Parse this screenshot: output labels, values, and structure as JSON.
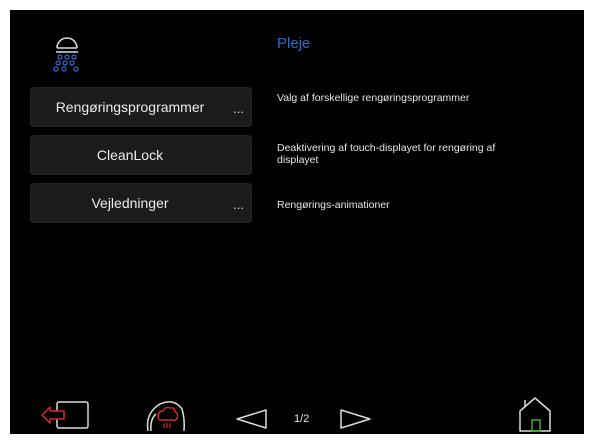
{
  "header": {
    "title": "Pleje",
    "icon": "shower-icon"
  },
  "menu": [
    {
      "label": "Rengøringsprogrammer",
      "has_more": true,
      "more": "...",
      "description": "Valg af forskellige rengøringsprogrammer"
    },
    {
      "label": "CleanLock",
      "has_more": false,
      "more": "",
      "description": "Deaktivering af touch-displayet for rengøring af displayet"
    },
    {
      "label": "Vejledninger",
      "has_more": true,
      "more": "...",
      "description": "Rengørings-animationer"
    }
  ],
  "footer": {
    "page_indicator": "1/2",
    "icons": [
      "exit-icon",
      "care-brush-icon",
      "previous-arrow-icon",
      "next-arrow-icon",
      "home-icon"
    ]
  },
  "colors": {
    "background": "#000000",
    "title_blue": "#2a6fc9",
    "icon_blue": "#2f6ed0",
    "exit_red": "#d8262b",
    "home_green": "#4aa83a"
  }
}
